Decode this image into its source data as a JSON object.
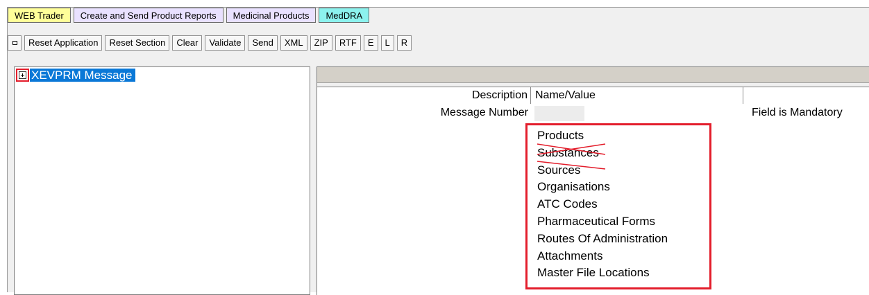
{
  "tabs": [
    {
      "label": "WEB Trader"
    },
    {
      "label": "Create and Send Product Reports"
    },
    {
      "label": "Medicinal Products"
    },
    {
      "label": "MedDRA"
    }
  ],
  "toolbar": {
    "reset_application": "Reset Application",
    "reset_section": "Reset Section",
    "clear": "Clear",
    "validate": "Validate",
    "send": "Send",
    "xml": "XML",
    "zip": "ZIP",
    "rtf": "RTF",
    "e": "E",
    "l": "L",
    "r": "R"
  },
  "tree": {
    "root_label": "XEVPRM Message"
  },
  "grid": {
    "col_description": "Description",
    "col_name_value": "Name/Value",
    "row": {
      "description": "Message Number",
      "note": "Field is Mandatory"
    }
  },
  "dropdown": {
    "items": [
      {
        "label": "Products",
        "crossed_out": false
      },
      {
        "label": "Substances",
        "crossed_out": true
      },
      {
        "label": "Sources",
        "crossed_out": true
      },
      {
        "label": "Organisations",
        "crossed_out": false
      },
      {
        "label": "ATC Codes",
        "crossed_out": false
      },
      {
        "label": "Pharmaceutical Forms",
        "crossed_out": false
      },
      {
        "label": "Routes Of Administration",
        "crossed_out": false
      },
      {
        "label": "Attachments",
        "crossed_out": false
      },
      {
        "label": "Master File Locations",
        "crossed_out": false
      }
    ]
  },
  "colors": {
    "highlight_red": "#e31d2b",
    "selection_blue": "#0a78d7",
    "tab_yellow": "#ffff99",
    "tab_lavender": "#e9e1ff",
    "tab_cyan": "#8cf2ee"
  }
}
